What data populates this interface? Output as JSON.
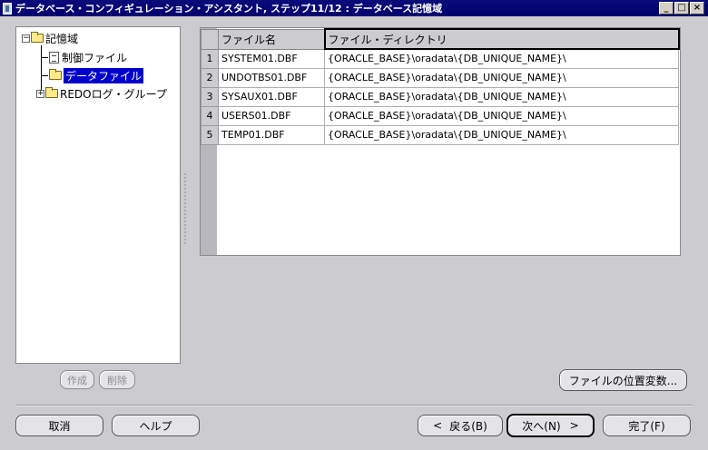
{
  "window": {
    "title": "データベース・コンフィギュレーション・アシスタント, ステップ11/12 : データベース記憶域",
    "controls": [
      "_",
      "□",
      "×"
    ]
  },
  "tree": {
    "root": "記憶域",
    "items": [
      {
        "label": "制御ファイル",
        "icon": "document-icon"
      },
      {
        "label": "データファイル",
        "icon": "folder-icon",
        "selected": true
      },
      {
        "label": "REDOログ・グループ",
        "icon": "folder-icon",
        "expandable": true
      }
    ],
    "create_button": "作成",
    "delete_button": "削除"
  },
  "table": {
    "columns": [
      "ファイル名",
      "ファイル・ディレクトリ"
    ],
    "rows": [
      {
        "num": "1",
        "file": "SYSTEM01.DBF",
        "dir": "{ORACLE_BASE}\\oradata\\{DB_UNIQUE_NAME}\\"
      },
      {
        "num": "2",
        "file": "UNDOTBS01.DBF",
        "dir": "{ORACLE_BASE}\\oradata\\{DB_UNIQUE_NAME}\\"
      },
      {
        "num": "3",
        "file": "SYSAUX01.DBF",
        "dir": "{ORACLE_BASE}\\oradata\\{DB_UNIQUE_NAME}\\"
      },
      {
        "num": "4",
        "file": "USERS01.DBF",
        "dir": "{ORACLE_BASE}\\oradata\\{DB_UNIQUE_NAME}\\"
      },
      {
        "num": "5",
        "file": "TEMP01.DBF",
        "dir": "{ORACLE_BASE}\\oradata\\{DB_UNIQUE_NAME}\\"
      }
    ]
  },
  "file_location_button": "ファイルの位置変数...",
  "footer": {
    "cancel": "取消",
    "help": "ヘルプ",
    "back": "戻る(B)",
    "next": "次へ(N)",
    "finish": "完了(F)"
  },
  "colors": {
    "titlebar": "#00006e",
    "selection": "#0000cc",
    "dialog_bg": "#ccccd0"
  }
}
